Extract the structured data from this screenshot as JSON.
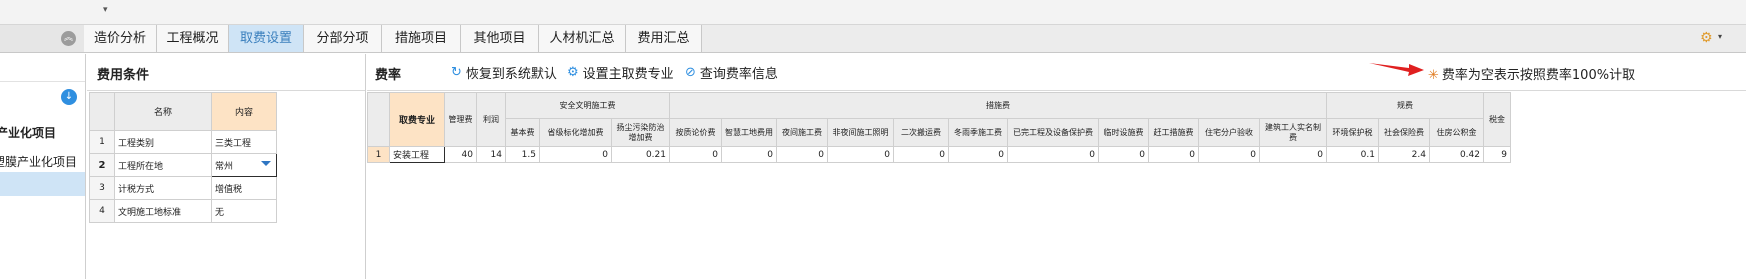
{
  "tabs": [
    {
      "label": "造价分析",
      "active": false
    },
    {
      "label": "工程概况",
      "active": false
    },
    {
      "label": "取费设置",
      "active": true
    },
    {
      "label": "分部分项",
      "active": false
    },
    {
      "label": "措施项目",
      "active": false
    },
    {
      "label": "其他项目",
      "active": false
    },
    {
      "label": "人材机汇总",
      "active": false
    },
    {
      "label": "费用汇总",
      "active": false
    }
  ],
  "project_tree": {
    "node1": "产业化项目",
    "node2": "塑膜产业化项目"
  },
  "conditions": {
    "title": "费用条件",
    "col_name": "名称",
    "col_content": "内容",
    "rows": [
      {
        "no": "1",
        "name": "工程类别",
        "value": "三类工程"
      },
      {
        "no": "2",
        "name": "工程所在地",
        "value": "常州"
      },
      {
        "no": "3",
        "name": "计税方式",
        "value": "增值税"
      },
      {
        "no": "4",
        "name": "文明施工地标准",
        "value": "无"
      }
    ]
  },
  "rates": {
    "title": "费率",
    "btn_restore": "恢复到系统默认",
    "btn_main_spec": "设置主取费专业",
    "btn_query": "查询费率信息",
    "note": "费率为空表示按照费率100%计取",
    "headers": {
      "spec": "取费专业",
      "mgmt": "管理费",
      "profit": "利润",
      "safety_group": "安全文明施工费",
      "measures_group": "措施费",
      "fees_group": "规费",
      "tax": "税金",
      "safety_cols": [
        "基本费",
        "省级标化增加费",
        "扬尘污染防治增加费"
      ],
      "measures_cols": [
        "按质论价费",
        "智慧工地费用",
        "夜间施工费",
        "非夜间施工照明",
        "二次搬运费",
        "冬雨季施工费",
        "已完工程及设备保护费",
        "临时设施费",
        "赶工措施费",
        "住宅分户验收",
        "建筑工人实名制费"
      ],
      "fees_cols": [
        "环境保护税",
        "社会保险费",
        "住房公积金"
      ]
    },
    "rows": [
      {
        "no": "1",
        "spec": "安装工程",
        "mgmt": "40",
        "profit": "14",
        "safety": [
          "1.5",
          "0",
          "0.21"
        ],
        "measures": [
          "0",
          "0",
          "0",
          "0",
          "0",
          "0",
          "0",
          "0",
          "0",
          "0",
          "0"
        ],
        "fees": [
          "0.1",
          "2.4",
          "0.42"
        ],
        "tax": "9"
      }
    ]
  },
  "icons": {
    "collapse": "double-chevron-up-icon",
    "down": "circle-down-icon",
    "restore": "restore-icon",
    "gear": "gear-icon",
    "query": "search-rate-icon",
    "note_star": "asterisk-icon",
    "arrow": "red-arrow-icon",
    "dropdown": "triangle-down-icon"
  },
  "colors": {
    "active_tab_bg": "#cfe4f6",
    "active_tab_text": "#3a7fbd",
    "highlight_header": "#fde3c5",
    "accent_blue": "#2f8fe0",
    "arrow_red": "#e02020",
    "note_star": "#e07a1f"
  }
}
